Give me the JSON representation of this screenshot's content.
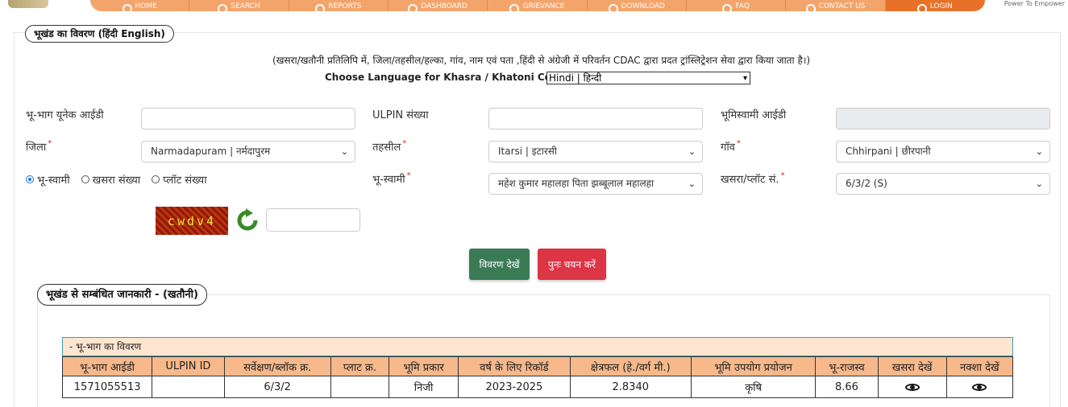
{
  "nav": {
    "items": [
      "HOME",
      "SEARCH",
      "REPORTS",
      "DASHBOARD",
      "GRIEVANCE",
      "DOWNLOAD",
      "FAQ",
      "CONTACT US",
      "LOGIN"
    ],
    "tagline": "Power To Empower"
  },
  "section1": {
    "title": "भूखंड का विवरण  (हिंदी  English)",
    "note": "(खसरा/खतौनी प्रतिलिपि में, जिला/तहसील/हल्का, गांव, नाम एवं पता ,हिंदी से अंग्रेजी में परिवर्तन CDAC द्वारा प्रदत ट्रांस्लिट्रेशन सेवा द्वारा किया जाता है।)",
    "language_label": "Choose Language for Khasra / Khatoni Copy:",
    "language_value": "Hindi | हिन्दी"
  },
  "form": {
    "unique_id_label": "भू-भाग यूनेक आईडी",
    "unique_id_value": "",
    "ulpin_label": "ULPIN संख्या",
    "ulpin_value": "",
    "owner_id_label": "भूमिस्वामी आईडी",
    "owner_id_value": "",
    "district_label": "जिला",
    "district_value": "Narmadapuram | नर्मदापुरम",
    "tehsil_label": "तहसील",
    "tehsil_value": "Itarsi | इटारसी",
    "village_label": "गॉव",
    "village_value": "Chhirpani | छीरपानी",
    "search_by": [
      "भू-स्वामी",
      "खसरा संख्या",
      "प्लॉट संख्या"
    ],
    "owner_label": "भू-स्वामी",
    "owner_value": "महेश कुमार महालहा पिता झब्बूलाल महालहा",
    "khasra_label": "खसरा/प्लॉट सं.",
    "khasra_value": "6/3/2 (S)",
    "required_mark": "*",
    "captcha_text": "cwdv4",
    "captcha_input": ""
  },
  "buttons": {
    "view": "विवरण देखें",
    "reset": "पुनः चयन करें"
  },
  "section2": {
    "title": "भूखंड से सम्बंधित जानकारी -   (खतौनी)",
    "table_caption": "- भू-भाग का विवरण",
    "columns": [
      "भू-भाग आईडी",
      "ULPIN ID",
      "सर्वेक्षण/ब्लॉक क्र.",
      "प्लाट क्र.",
      "भूमि प्रकार",
      "वर्ष के लिए रिकॉर्ड",
      "क्षेत्रफल (हे./वर्ग मी.)",
      "भूमि उपयोग प्रयोजन",
      "भू-राजस्व",
      "खसरा देखें",
      "नक्शा देखें"
    ],
    "rows": [
      [
        "1571055513",
        "",
        "6/3/2",
        "",
        "निजी",
        "2023-2025",
        "2.8340",
        "कृषि",
        "8.66",
        "eye-icon",
        "eye-icon"
      ]
    ]
  }
}
